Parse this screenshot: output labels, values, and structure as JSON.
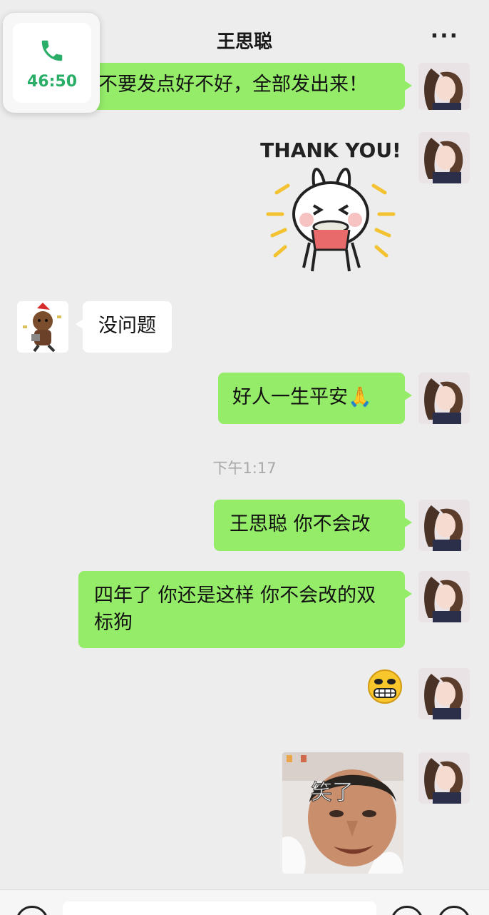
{
  "header": {
    "title": "王思聪",
    "more_label": "···"
  },
  "call_widget": {
    "time": "46:50",
    "icon": "phone-icon",
    "accent": "#2aae67"
  },
  "messages": {
    "m1": "不要发点好不好，全部发出来！",
    "m2_sticker_text": "THANK YOU!",
    "m3": "没问题",
    "m4": "好人一生平安🙏",
    "m5": "王思聪 你不会改",
    "m6": "四年了 你还是这样 你不会改的双标狗",
    "m7_emoji": "😬",
    "m8_sticker_text": "笑了"
  },
  "timestamp": "下午1:17",
  "colors": {
    "bubble_self": "#95ec69",
    "bubble_other": "#ffffff",
    "background": "#ededed"
  }
}
